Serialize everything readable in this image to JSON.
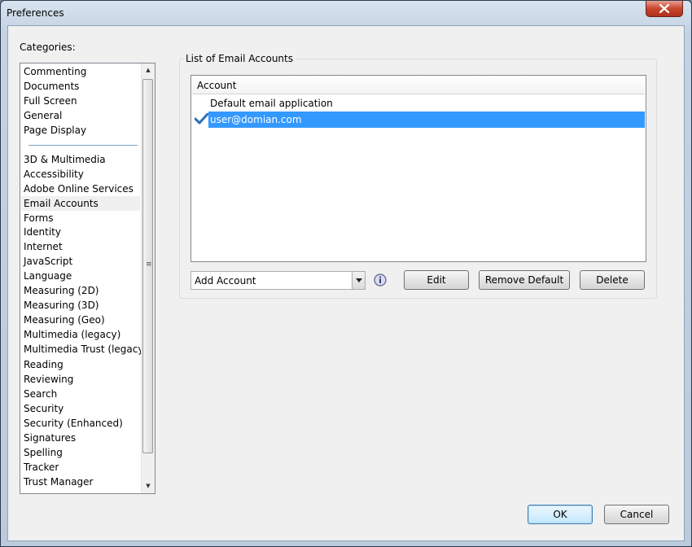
{
  "window": {
    "title": "Preferences"
  },
  "categories": {
    "label": "Categories:",
    "top_items": [
      "Commenting",
      "Documents",
      "Full Screen",
      "General",
      "Page Display"
    ],
    "items": [
      "3D & Multimedia",
      "Accessibility",
      "Adobe Online Services",
      "Email Accounts",
      "Forms",
      "Identity",
      "Internet",
      "JavaScript",
      "Language",
      "Measuring (2D)",
      "Measuring (3D)",
      "Measuring (Geo)",
      "Multimedia (legacy)",
      "Multimedia Trust (legacy)",
      "Reading",
      "Reviewing",
      "Search",
      "Security",
      "Security (Enhanced)",
      "Signatures",
      "Spelling",
      "Tracker",
      "Trust Manager"
    ],
    "selected": "Email Accounts"
  },
  "email_accounts": {
    "group_label": "List of Email Accounts",
    "column_header": "Account",
    "rows": [
      {
        "label": "Default email application",
        "checked": false,
        "selected": false
      },
      {
        "label": "user@domian.com",
        "checked": true,
        "selected": true
      }
    ]
  },
  "controls": {
    "add_account_value": "Add Account",
    "edit_label": "Edit",
    "remove_default_label": "Remove Default",
    "delete_label": "Delete"
  },
  "footer": {
    "ok_label": "OK",
    "cancel_label": "Cancel"
  },
  "colors": {
    "selection": "#3399ff",
    "check": "#2c6fb5"
  }
}
